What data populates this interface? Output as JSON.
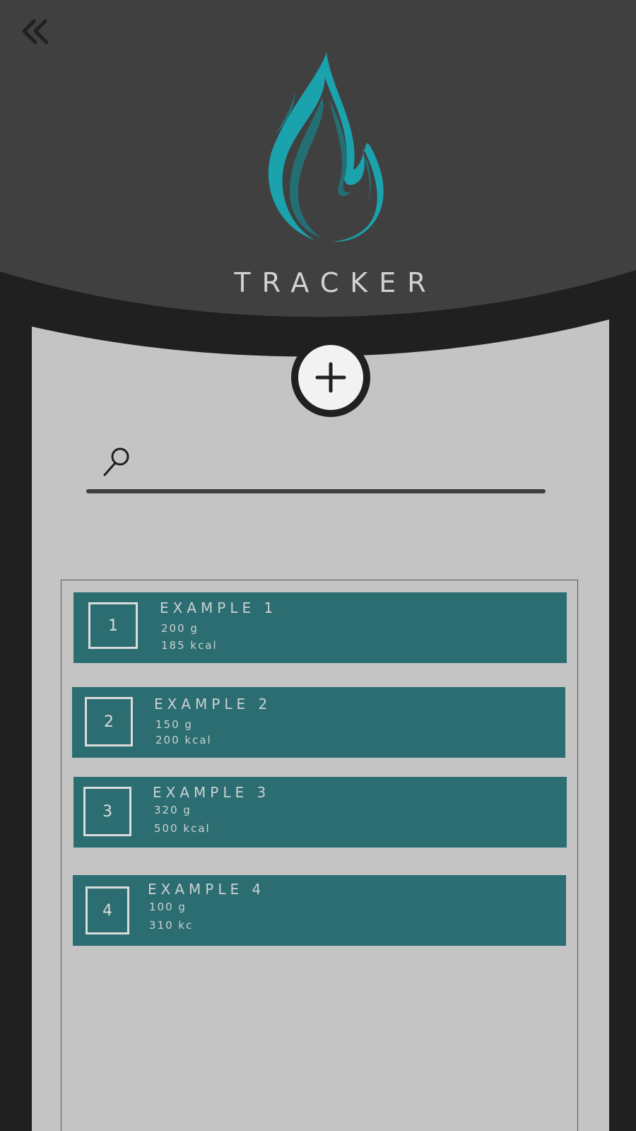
{
  "colors": {
    "header": "#404040",
    "frame": "#202020",
    "panel": "#c4c4c4",
    "entry": "#2c6d71",
    "flame_accent": "#1aa3ad",
    "flame_dark": "#246f74"
  },
  "header": {
    "back_icon": "chevron-double-left-icon",
    "logo_icon": "flame-icon",
    "title": "TRACKER"
  },
  "actions": {
    "add_icon": "plus-icon"
  },
  "search": {
    "icon": "search-icon",
    "placeholder": "",
    "value": ""
  },
  "entries": [
    {
      "thumb": "1",
      "name": "EXAMPLE 1",
      "weight": "200 g",
      "kcal": "185 kcal"
    },
    {
      "thumb": "2",
      "name": "EXAMPLE 2",
      "weight": "150 g",
      "kcal": "200 kcal"
    },
    {
      "thumb": "3",
      "name": "EXAMPLE 3",
      "weight": "320 g",
      "kcal": "500 kcal"
    },
    {
      "thumb": "4",
      "name": "EXAMPLE 4",
      "weight": "100 g",
      "kcal": "310 kc"
    }
  ]
}
